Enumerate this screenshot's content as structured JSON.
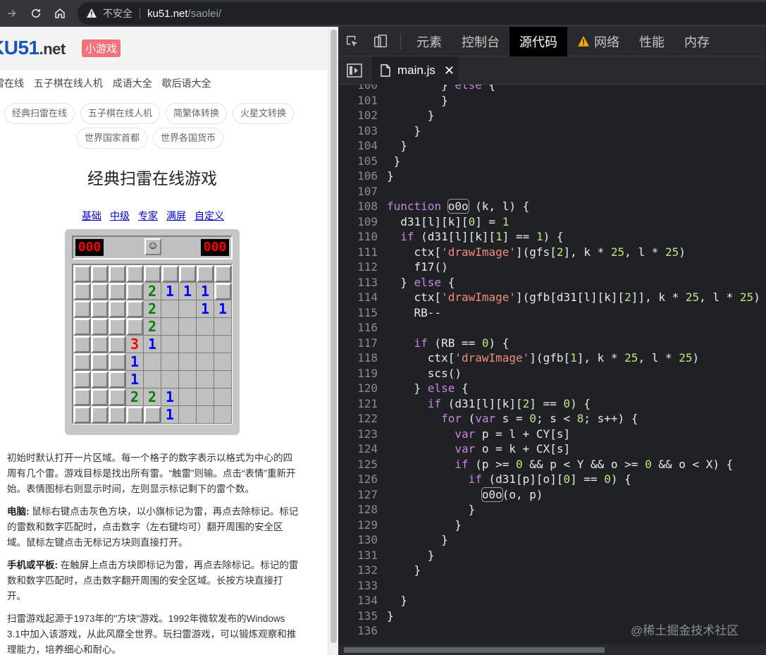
{
  "browser": {
    "security_label": "不安全",
    "url_host": "ku51.net",
    "url_path": "/saolei/"
  },
  "site": {
    "logo_main": "KU51",
    "logo_ext": ".net",
    "badge": "小游戏",
    "top_links": [
      "雷在线",
      "五子棋在线人机",
      "成语大全",
      "歇后语大全"
    ],
    "pills_row1": [
      "经典扫雷在线",
      "五子棋在线人机",
      "简繁体转换",
      "火星文转换"
    ],
    "pills_row2": [
      "世界国家首都",
      "世界各国货币"
    ],
    "game_title": "经典扫雷在线游戏",
    "levels": [
      "基础",
      "中级",
      "专家",
      "满屏",
      "自定义"
    ]
  },
  "minesweeper": {
    "mines_left_display": "000",
    "timer_display": "000",
    "face": "☺",
    "grid": [
      [
        "c",
        "c",
        "c",
        "c",
        "c",
        "c",
        "c",
        "c",
        "c"
      ],
      [
        "c",
        "c",
        "c",
        "c",
        "2",
        "1",
        "1",
        "1",
        "c"
      ],
      [
        "c",
        "c",
        "c",
        "c",
        "2",
        "",
        "",
        "1",
        "1"
      ],
      [
        "c",
        "c",
        "c",
        "c",
        "2",
        "",
        "",
        "",
        ""
      ],
      [
        "c",
        "c",
        "c",
        "3",
        "1",
        "",
        "",
        "",
        ""
      ],
      [
        "c",
        "c",
        "c",
        "1",
        "",
        "",
        "",
        "",
        ""
      ],
      [
        "c",
        "c",
        "c",
        "1",
        "",
        "",
        "",
        "",
        ""
      ],
      [
        "c",
        "c",
        "c",
        "2",
        "2",
        "1",
        "",
        "",
        ""
      ],
      [
        "c",
        "c",
        "c",
        "c",
        "c",
        "1",
        "",
        "",
        ""
      ]
    ]
  },
  "description": {
    "p1": "初始时默认打开一片区域。每一个格子的数字表示以格式为中心的四周有几个雷。游戏目标是找出所有雷。“触雷”则输。点击“表情”重新开始。表情图标右则显示时间，左则显示标记剩下的雷个数。",
    "p2_label": "电脑:",
    "p2": "鼠标右键点击灰色方块，以小旗标记为雷，再点去除标记。标记的雷数和数字匹配时，点击数字（左右键均可）翻开周围的安全区域。鼠标左键点击无标记方块则直接打开。",
    "p3_label": "手机或平板:",
    "p3": "在触屏上点击方块即标记为雷，再点去除标记。标记的雷数和数字匹配时，点击数字翻开周围的安全区域。长按方块直接打开。",
    "p4": "扫雷游戏起源于1973年的\"方块\"游戏。1992年微软发布的Windows 3.1中加入该游戏，从此风靡全世界。玩扫雷游戏，可以锻炼观察和推理能力，培养细心和耐心。"
  },
  "devtools": {
    "tabs": [
      "元素",
      "控制台",
      "源代码",
      "网络",
      "性能",
      "内存"
    ],
    "active_tab": "源代码",
    "file_name": "main.js",
    "code_lines": [
      {
        "n": "100",
        "html": "        <span class='fn'>}</span> <span class='kw'>else</span> {"
      },
      {
        "n": "101",
        "html": "        }"
      },
      {
        "n": "102",
        "html": "      }"
      },
      {
        "n": "103",
        "html": "    }"
      },
      {
        "n": "104",
        "html": "  }"
      },
      {
        "n": "105",
        "html": " }"
      },
      {
        "n": "106",
        "html": "}"
      },
      {
        "n": "107",
        "html": ""
      },
      {
        "n": "108",
        "html": "<span class='kw'>function</span> <span class='box'>o0o</span> (k, l) {"
      },
      {
        "n": "109",
        "html": "  d31[l][k][<span class='num'>0</span>] = <span class='num'>1</span>"
      },
      {
        "n": "110",
        "html": "  <span class='kw'>if</span> (d31[l][k][<span class='num'>1</span>] == <span class='num'>1</span>) {"
      },
      {
        "n": "111",
        "html": "    ctx[<span class='str'>'drawImage'</span>](gfs[<span class='num'>2</span>], k * <span class='num'>25</span>, l * <span class='num'>25</span>)"
      },
      {
        "n": "112",
        "html": "    f17()"
      },
      {
        "n": "113",
        "html": "  } <span class='kw'>else</span> {"
      },
      {
        "n": "114",
        "html": "    ctx[<span class='str'>'drawImage'</span>](gfb[d31[l][k][<span class='num'>2</span>]], k * <span class='num'>25</span>, l * <span class='num'>25</span>)"
      },
      {
        "n": "115",
        "html": "    RB--"
      },
      {
        "n": "116",
        "html": ""
      },
      {
        "n": "117",
        "html": "    <span class='kw'>if</span> (RB == <span class='num'>0</span>) {"
      },
      {
        "n": "118",
        "html": "      ctx[<span class='str'>'drawImage'</span>](gfb[<span class='num'>1</span>], k * <span class='num'>25</span>, l * <span class='num'>25</span>)"
      },
      {
        "n": "119",
        "html": "      scs()"
      },
      {
        "n": "120",
        "html": "    } <span class='kw'>else</span> {"
      },
      {
        "n": "121",
        "html": "      <span class='kw'>if</span> (d31[l][k][<span class='num'>2</span>] == <span class='num'>0</span>) {"
      },
      {
        "n": "122",
        "html": "        <span class='kw'>for</span> (<span class='kw'>var</span> s = <span class='num'>0</span>; s < <span class='num'>8</span>; s++) {"
      },
      {
        "n": "123",
        "html": "          <span class='kw'>var</span> p = l + CY[s]"
      },
      {
        "n": "124",
        "html": "          <span class='kw'>var</span> o = k + CX[s]"
      },
      {
        "n": "125",
        "html": "          <span class='kw'>if</span> (p >= <span class='num'>0</span> && p < Y && o >= <span class='num'>0</span> && o < X) {"
      },
      {
        "n": "126",
        "html": "            <span class='kw'>if</span> (d31[p][o][<span class='num'>0</span>] == <span class='num'>0</span>) {"
      },
      {
        "n": "127",
        "html": "              <span class='box'>o0o</span>(o, p)"
      },
      {
        "n": "128",
        "html": "            }"
      },
      {
        "n": "129",
        "html": "          }"
      },
      {
        "n": "130",
        "html": "        }"
      },
      {
        "n": "131",
        "html": "      }"
      },
      {
        "n": "132",
        "html": "    }"
      },
      {
        "n": "133",
        "html": ""
      },
      {
        "n": "134",
        "html": "  }"
      },
      {
        "n": "135",
        "html": "}"
      },
      {
        "n": "136",
        "html": ""
      }
    ]
  },
  "watermark": "@稀土掘金技术社区"
}
